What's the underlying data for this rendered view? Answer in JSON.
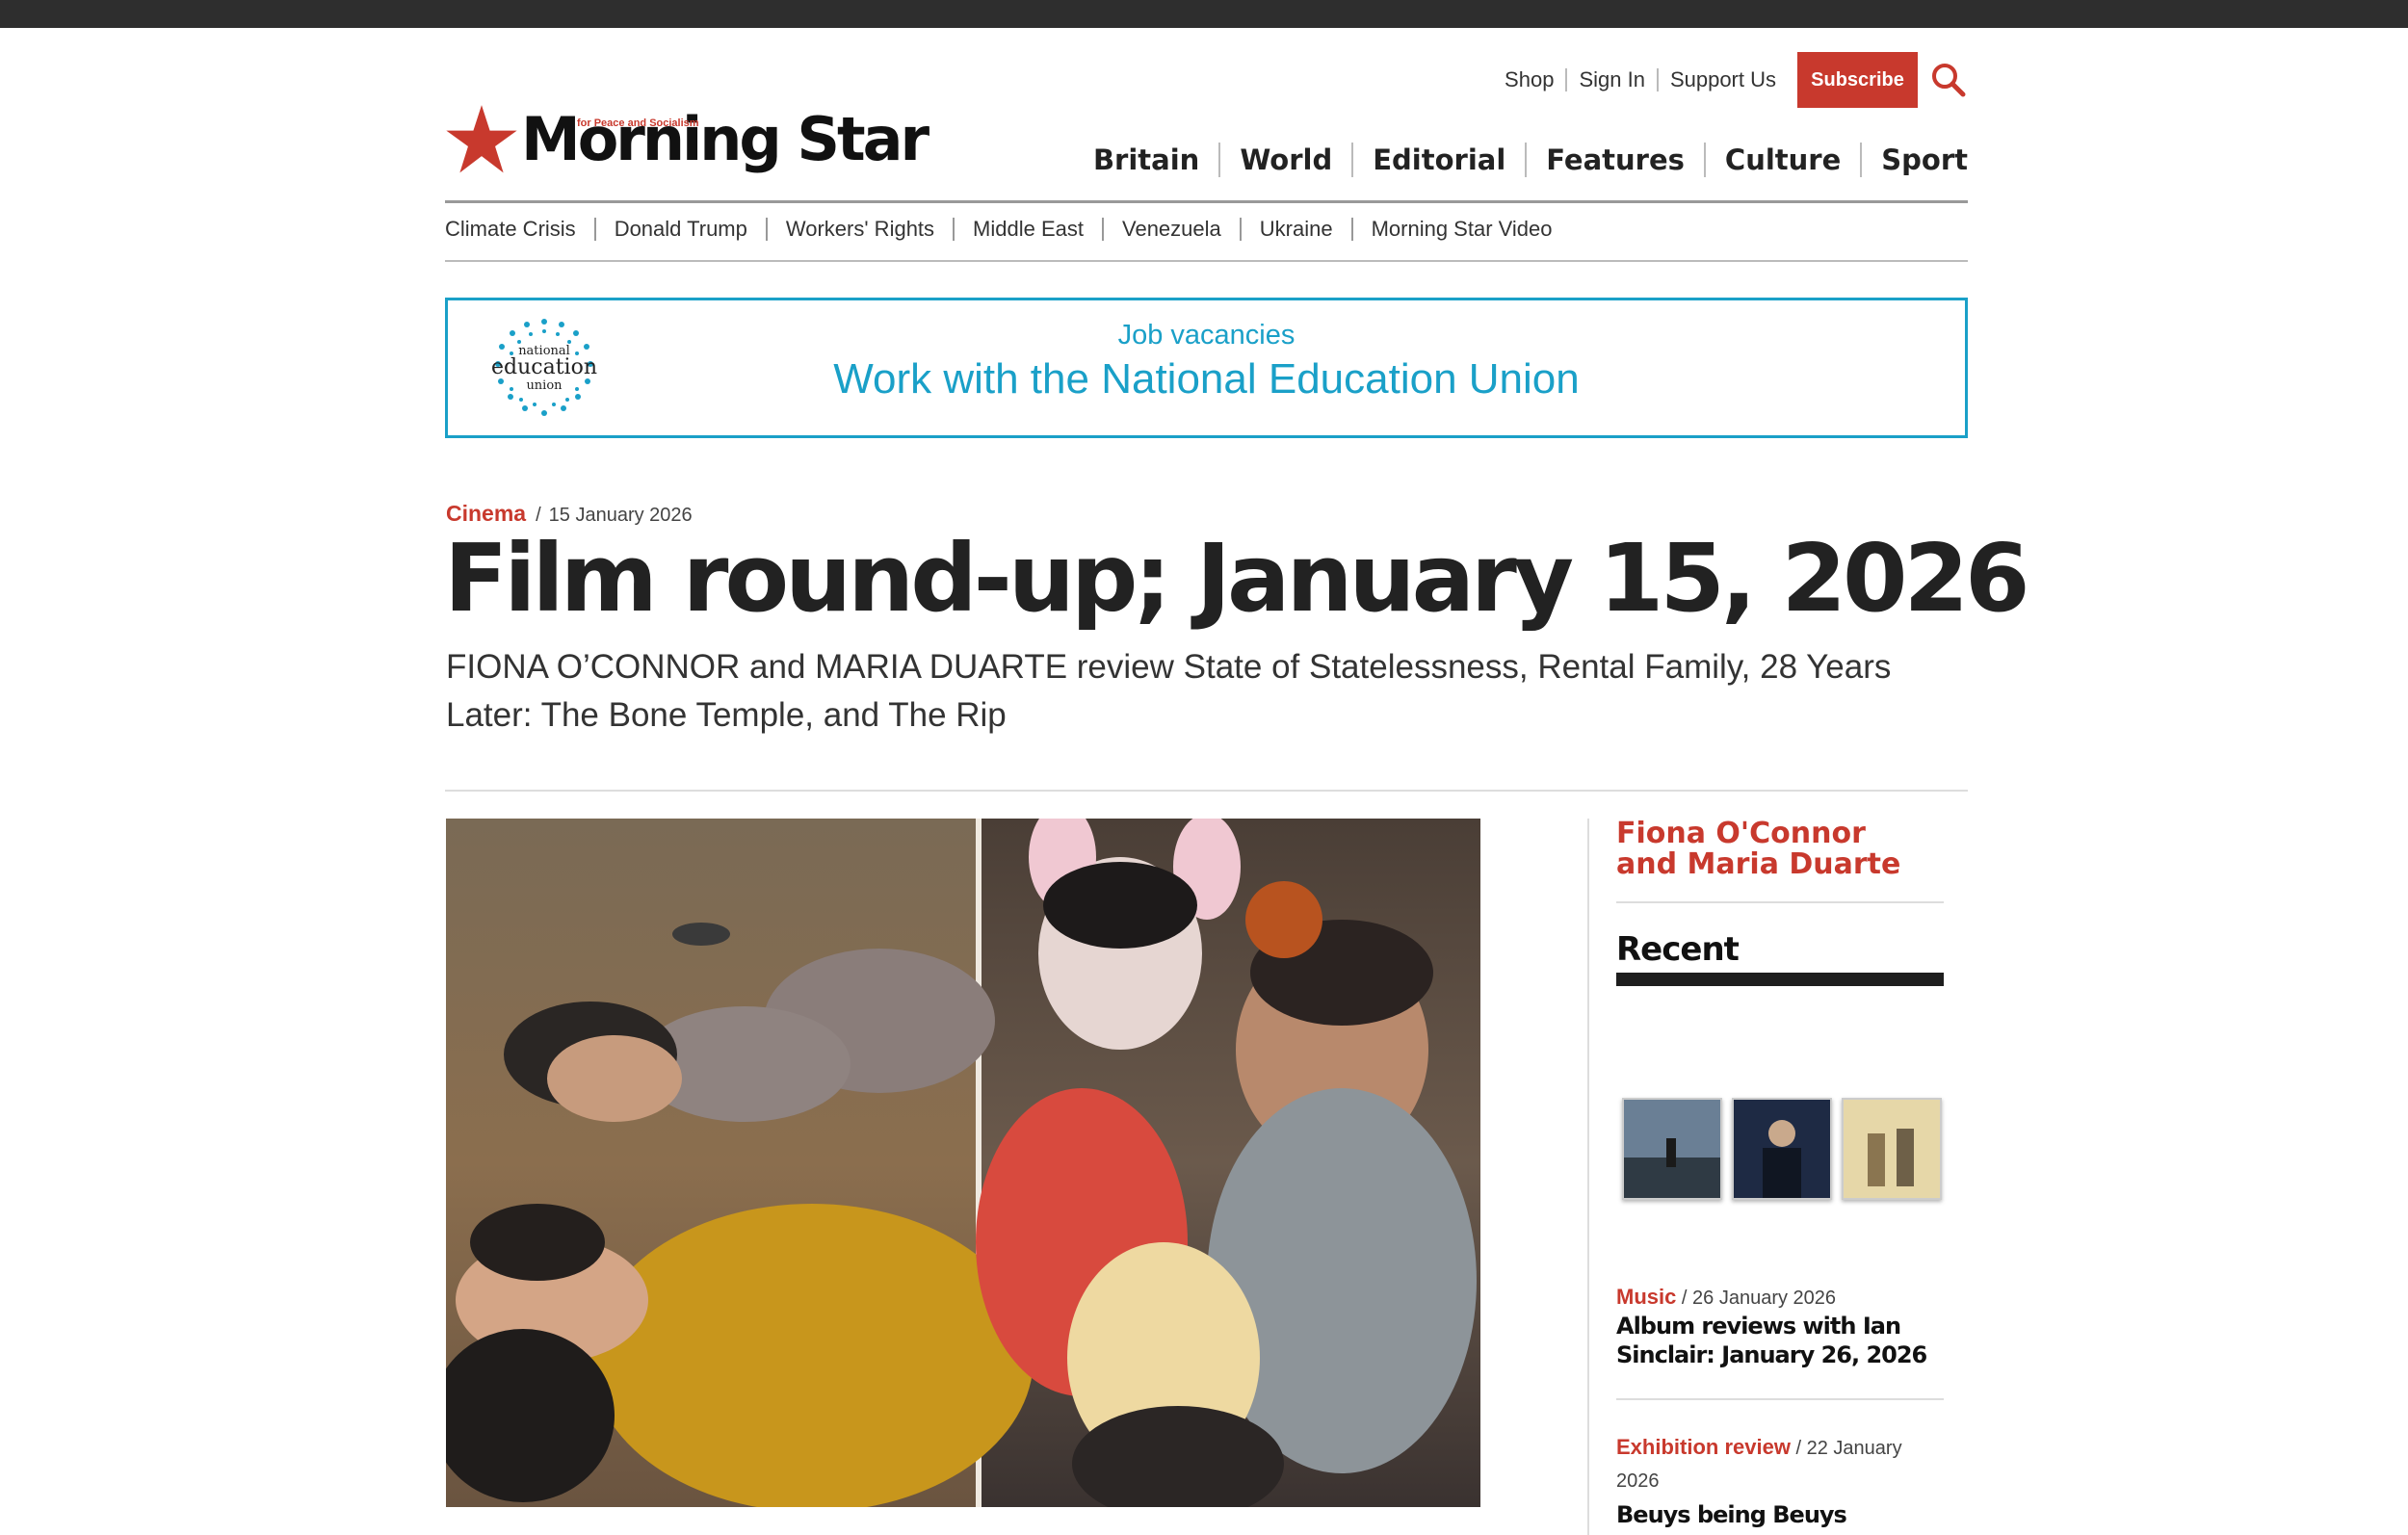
{
  "utility_nav": {
    "items": [
      "Shop",
      "Sign In",
      "Support Us"
    ],
    "subscribe_label": "Subscribe"
  },
  "logo": {
    "name": "Morning Star",
    "tagline": "for Peace and Socialism"
  },
  "main_nav": [
    "Britain",
    "World",
    "Editorial",
    "Features",
    "Culture",
    "Sport"
  ],
  "topic_nav": [
    "Climate Crisis",
    "Donald Trump",
    "Workers' Rights",
    "Middle East",
    "Venezuela",
    "Ukraine",
    "Morning Star Video"
  ],
  "ad": {
    "logo_lines": [
      "national",
      "education",
      "union"
    ],
    "small_text": "Job vacancies",
    "big_text": "Work with the National Education Union"
  },
  "article": {
    "category": "Cinema",
    "date": "15 January 2026",
    "headline": "Film round-up; January 15, 2026",
    "standfirst": "FIONA O’CONNOR and MARIA DUARTE review State of Statelessness, Rental Family, 28 Years Later: The Bone Temple, and The Rip"
  },
  "sidebar": {
    "author": "Fiona O'Connor and Maria Duarte",
    "recent_heading": "Recent",
    "recent": [
      {
        "category": "Music",
        "date": "26 January 2026",
        "title": "Album reviews with Ian Sinclair: January 26, 2026"
      },
      {
        "category": "Exhibition review",
        "date": "22 January 2026",
        "title": "Beuys being Beuys"
      }
    ]
  },
  "colors": {
    "accent": "#c8392d",
    "ad_blue": "#1aa0c8",
    "text": "#222222"
  }
}
